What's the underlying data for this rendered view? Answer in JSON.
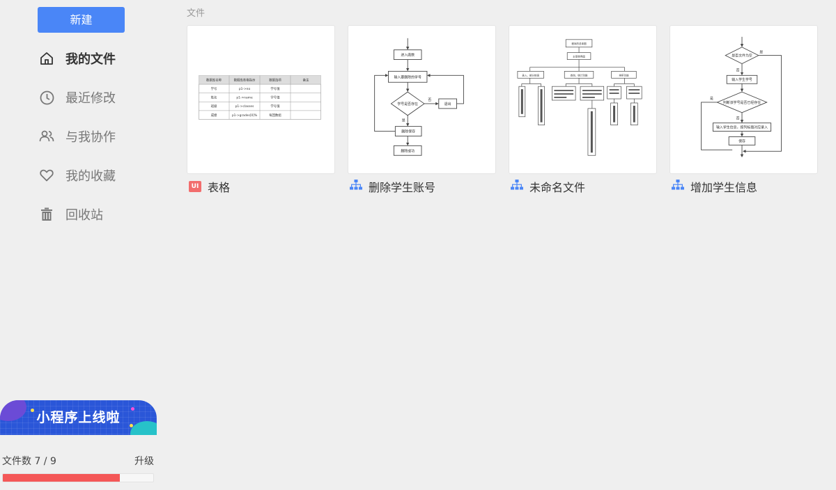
{
  "sidebar": {
    "new_button": "新建",
    "nav": [
      {
        "label": "我的文件",
        "icon": "home-icon",
        "active": true
      },
      {
        "label": "最近修改",
        "icon": "clock-icon"
      },
      {
        "label": "与我协作",
        "icon": "users-icon"
      },
      {
        "label": "我的收藏",
        "icon": "heart-icon"
      },
      {
        "label": "回收站",
        "icon": "trash-icon"
      }
    ],
    "promo": {
      "text": "小程序上线啦"
    },
    "quota": {
      "label": "文件数 7 / 9",
      "upgrade": "升级",
      "used": 7,
      "total": 9
    }
  },
  "main": {
    "section_title": "文件",
    "files": [
      {
        "title": "表格",
        "type_icon": "ui-icon",
        "type_badge": "UI",
        "table": {
          "headers": [
            "数据库名称",
            "数据库表格指示",
            "数据选项",
            "备注"
          ],
          "rows": [
            [
              "学号",
              "p1->no",
              "学号值",
              ""
            ],
            [
              "姓名",
              "p1->name",
              "学号值",
              ""
            ],
            [
              "班级",
              "p1->classes",
              "学号值",
              ""
            ],
            [
              "成绩",
              "p1->grades[0]%",
              "每回数组",
              ""
            ]
          ]
        }
      },
      {
        "title": "删除学生账号",
        "type_icon": "flowchart-icon",
        "flow": {
          "n1": "进入函数",
          "n2": "输入要删除的学号",
          "n3": "学号是否存在",
          "n4": "删除保存",
          "n5": "删除成功",
          "n6": "退出",
          "yes": "是",
          "no": "否"
        }
      },
      {
        "title": "未命名文件",
        "type_icon": "flowchart-icon",
        "tree": {
          "root": "程序的总体图",
          "sub": "主菜单界面",
          "b1": "录入、部分信息",
          "b2": "查询、统计功能",
          "b3": "排序功能",
          "c1": "从文件导入信息",
          "c2": "逐步从主界面导入信息",
          "c3": "按照学号查找学生信息后",
          "c4": "按照学号统计学生信息后",
          "c5": "按照学号排序",
          "c6": "删除学生信息",
          "d1": "保存到文件后输出",
          "d2": "保存全部",
          "d3": "保存文件"
        }
      },
      {
        "title": "增加学生信息",
        "type_icon": "flowchart-icon",
        "flow": {
          "n1": "是否文件为空",
          "n2": "输入学生学号",
          "n3": "判断该学号是否已经存在",
          "n4": "输入学生信息，按列标题对应录入",
          "n5": "保存",
          "yes": "是",
          "no": "否"
        }
      }
    ]
  },
  "colors": {
    "primary": "#4a86f7",
    "danger": "#f45757",
    "promo": "#2a56d8"
  }
}
